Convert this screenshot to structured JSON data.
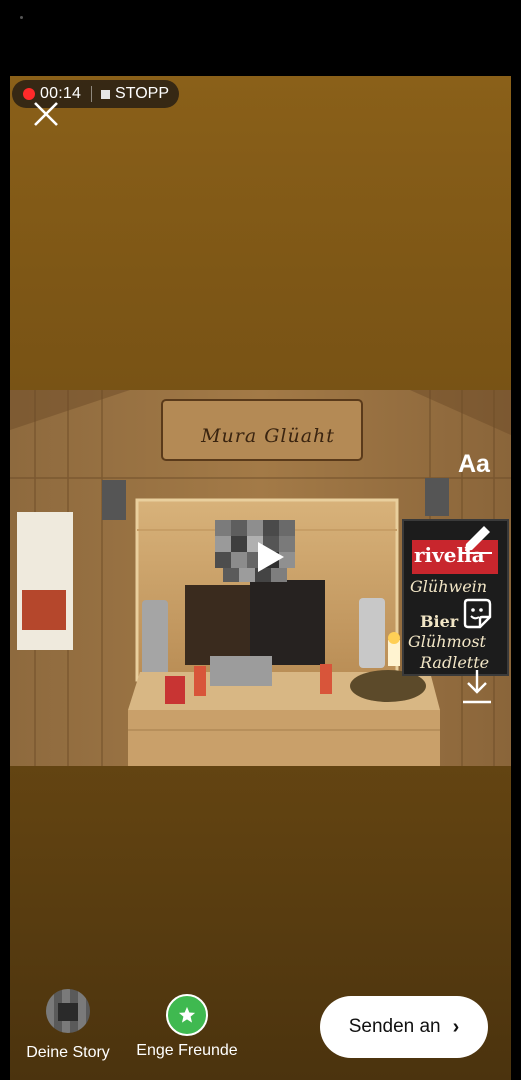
{
  "recording": {
    "time": "00:14",
    "stop_label": "STOPP",
    "record_color": "#ff2a2a"
  },
  "photo": {
    "sign_text": "Mura Glüaht",
    "board_lines": [
      "rivella",
      "Glühwein",
      "Bier",
      "Glühmost",
      "Radlette"
    ]
  },
  "tools": {
    "text_label": "Aa",
    "icons": [
      "pen-icon",
      "sticker-icon",
      "download-icon"
    ]
  },
  "bottom": {
    "story_label": "Deine Story",
    "friends_label": "Enge Freunde",
    "send_label": "Senden an",
    "friends_color": "#3fb950"
  },
  "icons": [
    "close-icon",
    "star-icon",
    "chevron-right-icon",
    "play-icon"
  ]
}
